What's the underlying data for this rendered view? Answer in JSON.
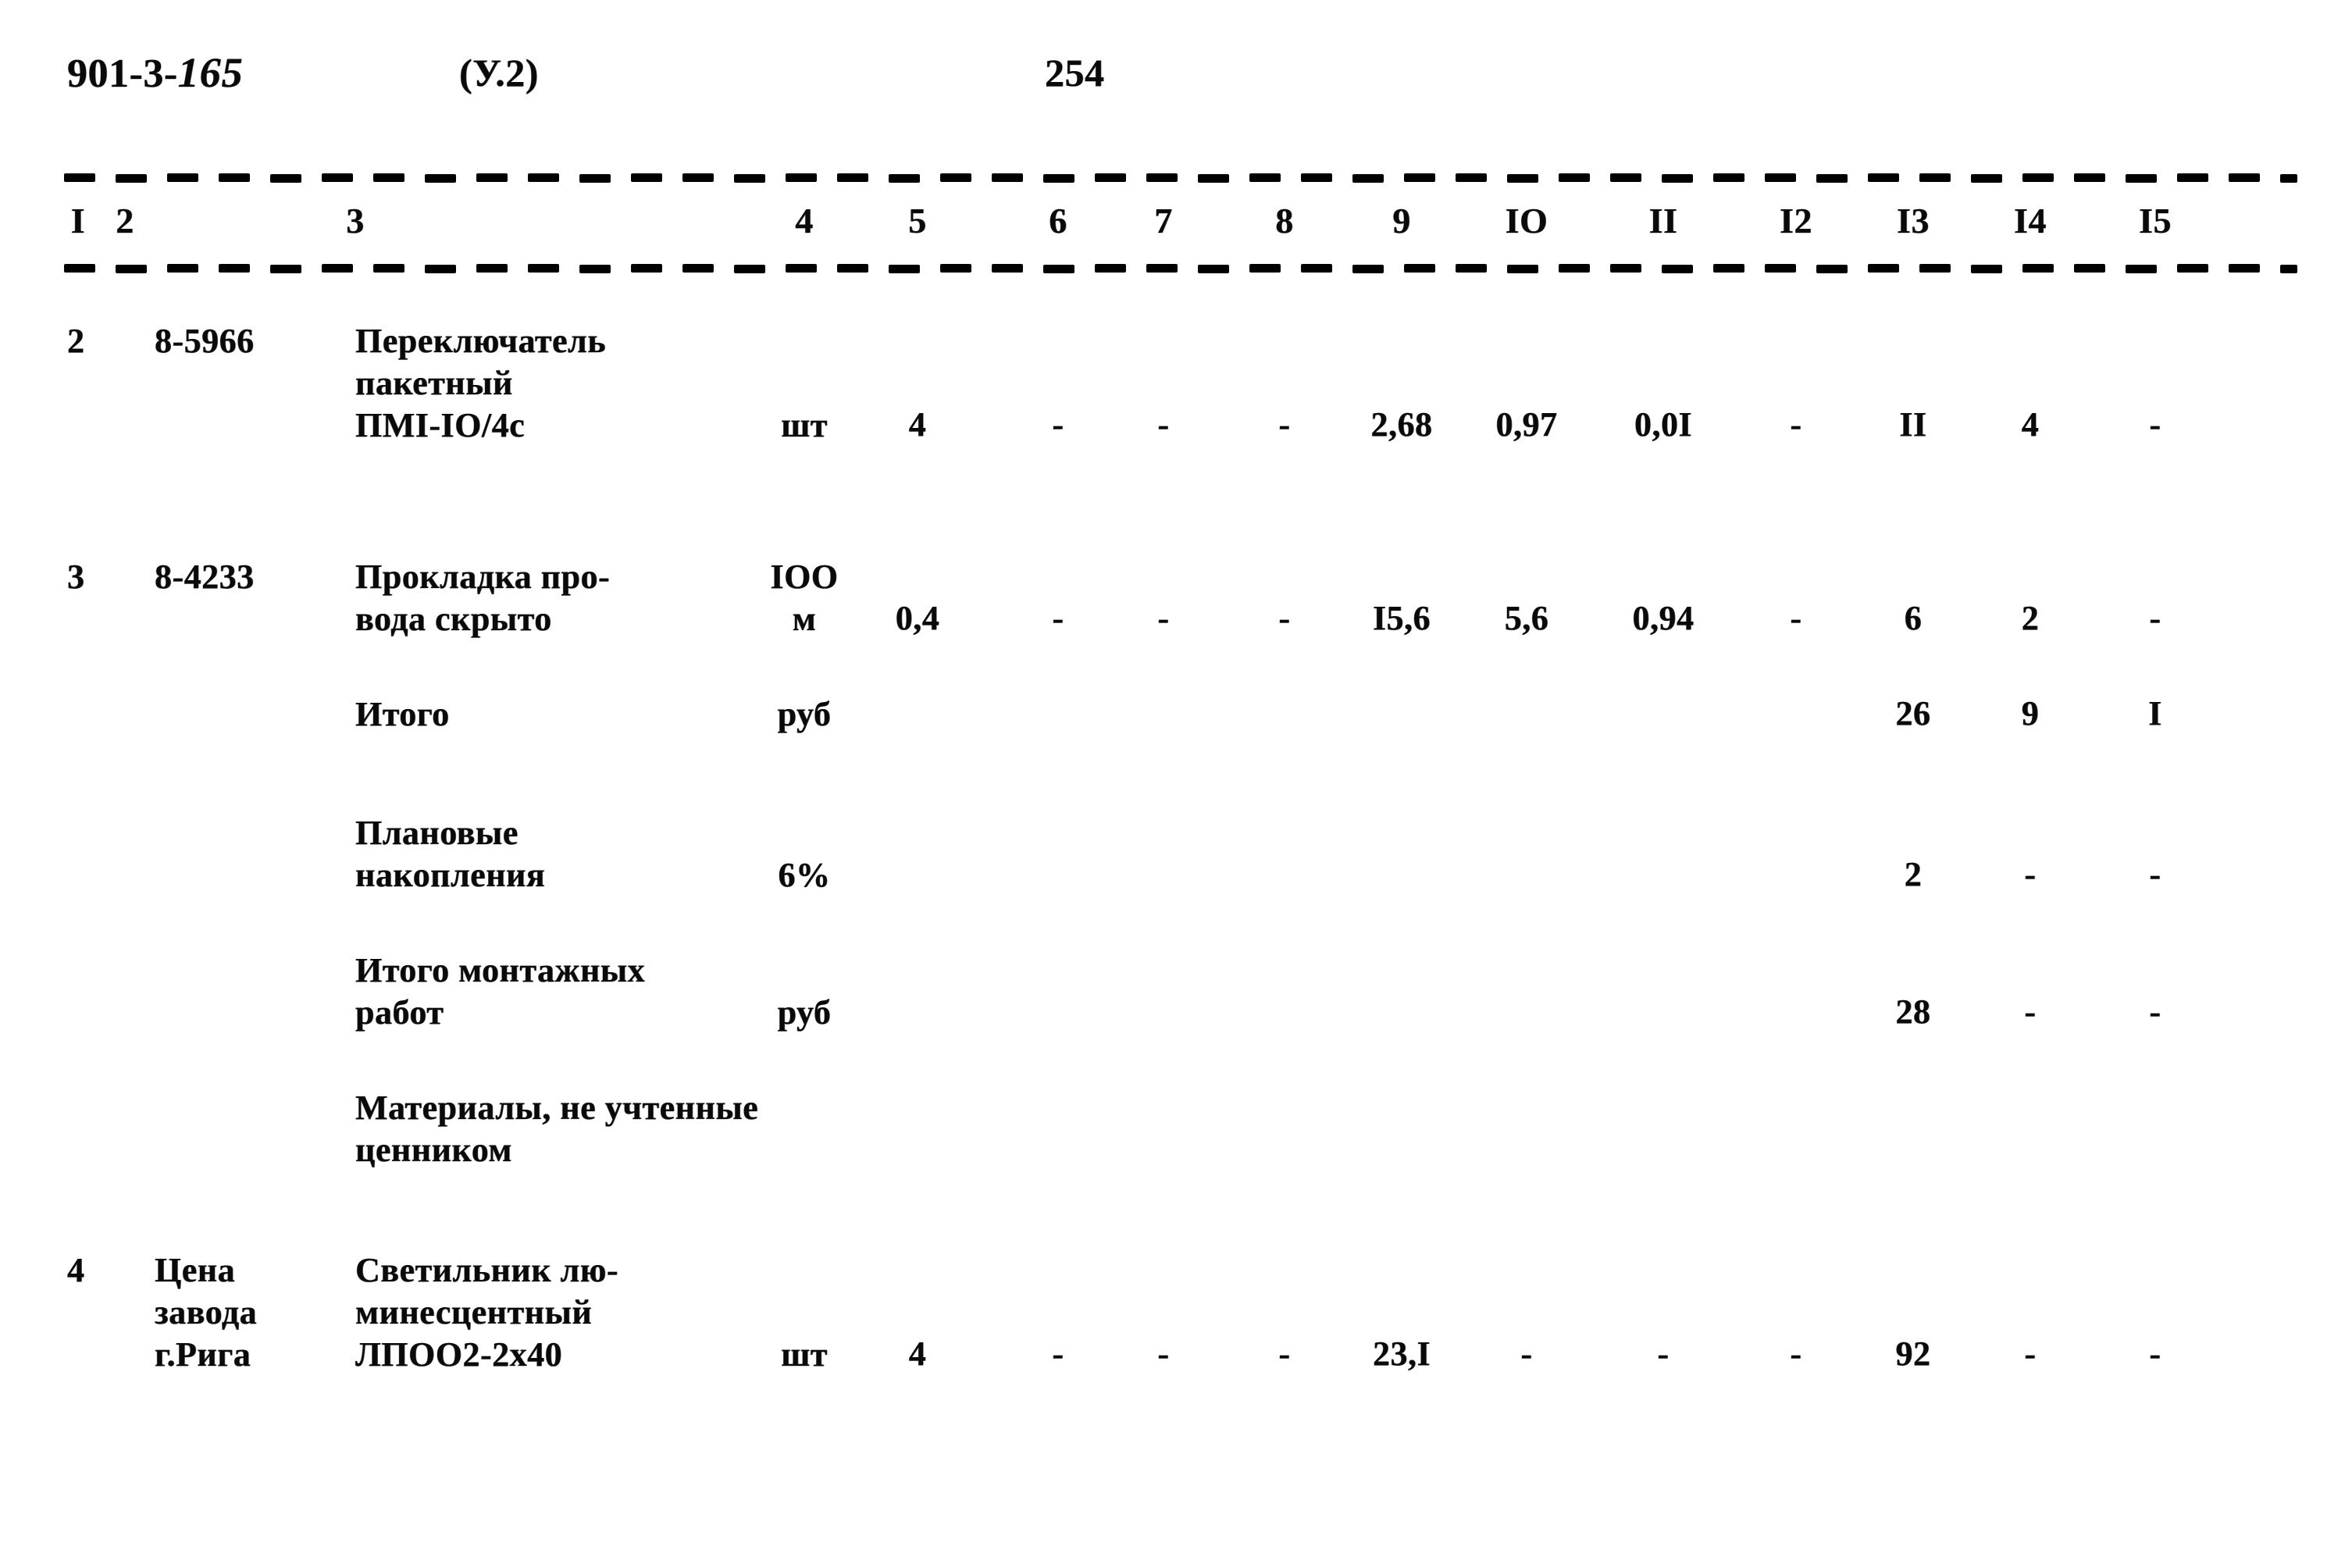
{
  "header": {
    "doc_code_prefix": "901-3-",
    "doc_code_suffix": "165",
    "sheet_mark": "(У.2)",
    "page_number": "254"
  },
  "table": {
    "column_headers": [
      "I",
      "2",
      "3",
      "4",
      "5",
      "6",
      "7",
      "8",
      "9",
      "IO",
      "II",
      "I2",
      "I3",
      "I4",
      "I5"
    ],
    "rows": [
      {
        "num": "2",
        "code": "8-5966",
        "description": "Переключатель\nпакетный\nПМI-IO/4с",
        "unit": "шт",
        "values": [
          "4",
          "-",
          "-",
          "-",
          "2,68",
          "0,97",
          "0,0I",
          "-",
          "II",
          "4",
          "-"
        ]
      },
      {
        "num": "3",
        "code": "8-4233",
        "description": "Прокладка про-\nвода скрыто",
        "unit": "IOO\nм",
        "values": [
          "0,4",
          "-",
          "-",
          "-",
          "I5,6",
          "5,6",
          "0,94",
          "-",
          "6",
          "2",
          "-"
        ]
      },
      {
        "num": "",
        "code": "",
        "description": "Итого",
        "unit": "руб",
        "values": [
          "",
          "",
          "",
          "",
          "",
          "",
          "",
          "",
          "26",
          "9",
          "I"
        ]
      },
      {
        "num": "",
        "code": "",
        "description": "Плановые\nнакопления",
        "unit": "6%",
        "values": [
          "",
          "",
          "",
          "",
          "",
          "",
          "",
          "",
          "2",
          "-",
          "-"
        ]
      },
      {
        "num": "",
        "code": "",
        "description": "Итого монтажных\nработ",
        "unit": "руб",
        "values": [
          "",
          "",
          "",
          "",
          "",
          "",
          "",
          "",
          "28",
          "-",
          "-"
        ]
      },
      {
        "num": "",
        "code": "",
        "description": "Материалы, не учтенные\n      ценником",
        "unit": "",
        "values": [
          "",
          "",
          "",
          "",
          "",
          "",
          "",
          "",
          "",
          "",
          ""
        ]
      },
      {
        "num": "4",
        "code": "Цена\nзавода\nг.Рига",
        "description": "Светильник лю-\nминесцентный\nЛПОО2-2х40",
        "unit": "шт",
        "values": [
          "4",
          "-",
          "-",
          "-",
          "23,I",
          "-",
          "-",
          "-",
          "92",
          "-",
          "-"
        ]
      }
    ]
  }
}
